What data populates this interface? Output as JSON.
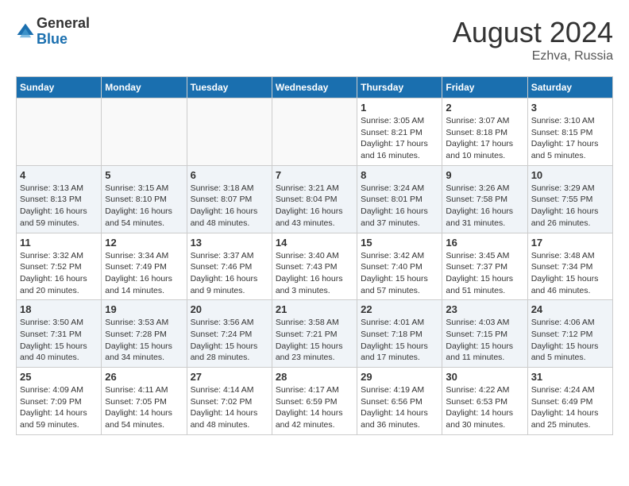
{
  "header": {
    "logo_general": "General",
    "logo_blue": "Blue",
    "month_year": "August 2024",
    "location": "Ezhva, Russia"
  },
  "weekdays": [
    "Sunday",
    "Monday",
    "Tuesday",
    "Wednesday",
    "Thursday",
    "Friday",
    "Saturday"
  ],
  "weeks": [
    [
      {
        "day": "",
        "sunrise": "",
        "sunset": "",
        "daylight": "",
        "empty": true
      },
      {
        "day": "",
        "sunrise": "",
        "sunset": "",
        "daylight": "",
        "empty": true
      },
      {
        "day": "",
        "sunrise": "",
        "sunset": "",
        "daylight": "",
        "empty": true
      },
      {
        "day": "",
        "sunrise": "",
        "sunset": "",
        "daylight": "",
        "empty": true
      },
      {
        "day": "1",
        "sunrise": "Sunrise: 3:05 AM",
        "sunset": "Sunset: 8:21 PM",
        "daylight": "Daylight: 17 hours and 16 minutes.",
        "empty": false
      },
      {
        "day": "2",
        "sunrise": "Sunrise: 3:07 AM",
        "sunset": "Sunset: 8:18 PM",
        "daylight": "Daylight: 17 hours and 10 minutes.",
        "empty": false
      },
      {
        "day": "3",
        "sunrise": "Sunrise: 3:10 AM",
        "sunset": "Sunset: 8:15 PM",
        "daylight": "Daylight: 17 hours and 5 minutes.",
        "empty": false
      }
    ],
    [
      {
        "day": "4",
        "sunrise": "Sunrise: 3:13 AM",
        "sunset": "Sunset: 8:13 PM",
        "daylight": "Daylight: 16 hours and 59 minutes.",
        "empty": false
      },
      {
        "day": "5",
        "sunrise": "Sunrise: 3:15 AM",
        "sunset": "Sunset: 8:10 PM",
        "daylight": "Daylight: 16 hours and 54 minutes.",
        "empty": false
      },
      {
        "day": "6",
        "sunrise": "Sunrise: 3:18 AM",
        "sunset": "Sunset: 8:07 PM",
        "daylight": "Daylight: 16 hours and 48 minutes.",
        "empty": false
      },
      {
        "day": "7",
        "sunrise": "Sunrise: 3:21 AM",
        "sunset": "Sunset: 8:04 PM",
        "daylight": "Daylight: 16 hours and 43 minutes.",
        "empty": false
      },
      {
        "day": "8",
        "sunrise": "Sunrise: 3:24 AM",
        "sunset": "Sunset: 8:01 PM",
        "daylight": "Daylight: 16 hours and 37 minutes.",
        "empty": false
      },
      {
        "day": "9",
        "sunrise": "Sunrise: 3:26 AM",
        "sunset": "Sunset: 7:58 PM",
        "daylight": "Daylight: 16 hours and 31 minutes.",
        "empty": false
      },
      {
        "day": "10",
        "sunrise": "Sunrise: 3:29 AM",
        "sunset": "Sunset: 7:55 PM",
        "daylight": "Daylight: 16 hours and 26 minutes.",
        "empty": false
      }
    ],
    [
      {
        "day": "11",
        "sunrise": "Sunrise: 3:32 AM",
        "sunset": "Sunset: 7:52 PM",
        "daylight": "Daylight: 16 hours and 20 minutes.",
        "empty": false
      },
      {
        "day": "12",
        "sunrise": "Sunrise: 3:34 AM",
        "sunset": "Sunset: 7:49 PM",
        "daylight": "Daylight: 16 hours and 14 minutes.",
        "empty": false
      },
      {
        "day": "13",
        "sunrise": "Sunrise: 3:37 AM",
        "sunset": "Sunset: 7:46 PM",
        "daylight": "Daylight: 16 hours and 9 minutes.",
        "empty": false
      },
      {
        "day": "14",
        "sunrise": "Sunrise: 3:40 AM",
        "sunset": "Sunset: 7:43 PM",
        "daylight": "Daylight: 16 hours and 3 minutes.",
        "empty": false
      },
      {
        "day": "15",
        "sunrise": "Sunrise: 3:42 AM",
        "sunset": "Sunset: 7:40 PM",
        "daylight": "Daylight: 15 hours and 57 minutes.",
        "empty": false
      },
      {
        "day": "16",
        "sunrise": "Sunrise: 3:45 AM",
        "sunset": "Sunset: 7:37 PM",
        "daylight": "Daylight: 15 hours and 51 minutes.",
        "empty": false
      },
      {
        "day": "17",
        "sunrise": "Sunrise: 3:48 AM",
        "sunset": "Sunset: 7:34 PM",
        "daylight": "Daylight: 15 hours and 46 minutes.",
        "empty": false
      }
    ],
    [
      {
        "day": "18",
        "sunrise": "Sunrise: 3:50 AM",
        "sunset": "Sunset: 7:31 PM",
        "daylight": "Daylight: 15 hours and 40 minutes.",
        "empty": false
      },
      {
        "day": "19",
        "sunrise": "Sunrise: 3:53 AM",
        "sunset": "Sunset: 7:28 PM",
        "daylight": "Daylight: 15 hours and 34 minutes.",
        "empty": false
      },
      {
        "day": "20",
        "sunrise": "Sunrise: 3:56 AM",
        "sunset": "Sunset: 7:24 PM",
        "daylight": "Daylight: 15 hours and 28 minutes.",
        "empty": false
      },
      {
        "day": "21",
        "sunrise": "Sunrise: 3:58 AM",
        "sunset": "Sunset: 7:21 PM",
        "daylight": "Daylight: 15 hours and 23 minutes.",
        "empty": false
      },
      {
        "day": "22",
        "sunrise": "Sunrise: 4:01 AM",
        "sunset": "Sunset: 7:18 PM",
        "daylight": "Daylight: 15 hours and 17 minutes.",
        "empty": false
      },
      {
        "day": "23",
        "sunrise": "Sunrise: 4:03 AM",
        "sunset": "Sunset: 7:15 PM",
        "daylight": "Daylight: 15 hours and 11 minutes.",
        "empty": false
      },
      {
        "day": "24",
        "sunrise": "Sunrise: 4:06 AM",
        "sunset": "Sunset: 7:12 PM",
        "daylight": "Daylight: 15 hours and 5 minutes.",
        "empty": false
      }
    ],
    [
      {
        "day": "25",
        "sunrise": "Sunrise: 4:09 AM",
        "sunset": "Sunset: 7:09 PM",
        "daylight": "Daylight: 14 hours and 59 minutes.",
        "empty": false
      },
      {
        "day": "26",
        "sunrise": "Sunrise: 4:11 AM",
        "sunset": "Sunset: 7:05 PM",
        "daylight": "Daylight: 14 hours and 54 minutes.",
        "empty": false
      },
      {
        "day": "27",
        "sunrise": "Sunrise: 4:14 AM",
        "sunset": "Sunset: 7:02 PM",
        "daylight": "Daylight: 14 hours and 48 minutes.",
        "empty": false
      },
      {
        "day": "28",
        "sunrise": "Sunrise: 4:17 AM",
        "sunset": "Sunset: 6:59 PM",
        "daylight": "Daylight: 14 hours and 42 minutes.",
        "empty": false
      },
      {
        "day": "29",
        "sunrise": "Sunrise: 4:19 AM",
        "sunset": "Sunset: 6:56 PM",
        "daylight": "Daylight: 14 hours and 36 minutes.",
        "empty": false
      },
      {
        "day": "30",
        "sunrise": "Sunrise: 4:22 AM",
        "sunset": "Sunset: 6:53 PM",
        "daylight": "Daylight: 14 hours and 30 minutes.",
        "empty": false
      },
      {
        "day": "31",
        "sunrise": "Sunrise: 4:24 AM",
        "sunset": "Sunset: 6:49 PM",
        "daylight": "Daylight: 14 hours and 25 minutes.",
        "empty": false
      }
    ]
  ]
}
